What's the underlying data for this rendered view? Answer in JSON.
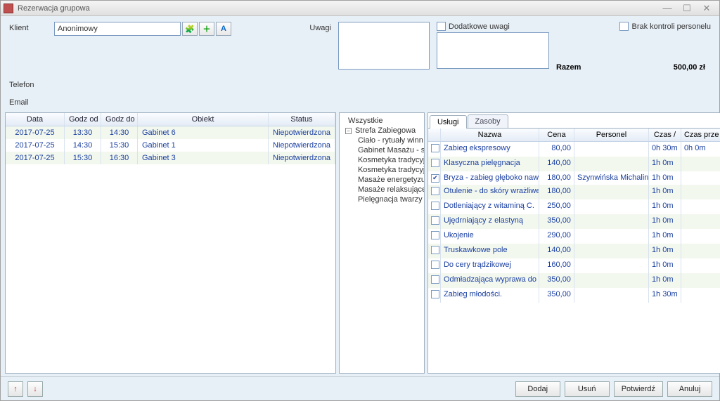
{
  "window": {
    "title": "Rezerwacja grupowa"
  },
  "labels": {
    "klient": "Klient",
    "telefon": "Telefon",
    "email": "Email",
    "uwagi": "Uwagi",
    "dodatkowe_uwagi": "Dodatkowe uwagi",
    "brak_kontroli": "Brak kontroli personelu",
    "razem": "Razem",
    "razem_val": "500,00 zł"
  },
  "client": {
    "value": "Anonimowy"
  },
  "left_grid": {
    "headers": {
      "data": "Data",
      "godz_od": "Godz od",
      "godz_do": "Godz do",
      "obiekt": "Obiekt",
      "status": "Status"
    },
    "rows": [
      {
        "data": "2017-07-25",
        "od": "13:30",
        "do": "14:30",
        "obiekt": "Gabinet 6",
        "status": "Niepotwierdzona"
      },
      {
        "data": "2017-07-25",
        "od": "14:30",
        "do": "15:30",
        "obiekt": "Gabinet 1",
        "status": "Niepotwierdzona"
      },
      {
        "data": "2017-07-25",
        "od": "15:30",
        "do": "16:30",
        "obiekt": "Gabinet 3",
        "status": "Niepotwierdzona"
      }
    ]
  },
  "tree": {
    "root": "Wszystkie",
    "group": "Strefa Zabiegowa",
    "children": [
      "Ciało - rytuały winn",
      "Gabinet Masażu - sta",
      "Kosmetyka tradycyjna",
      "Kosmetyka tradycyjna",
      "Masaże energetyzując",
      "Masaże relaksujące",
      "Pielęgnacja twarzy -"
    ]
  },
  "tabs": {
    "uslugi": "Usługi",
    "zasoby": "Zasoby"
  },
  "services": {
    "headers": {
      "nazwa": "Nazwa",
      "cena": "Cena",
      "personel": "Personel",
      "czas": "Czas  /",
      "czas_prz": "Czas prze"
    },
    "rows": [
      {
        "chk": false,
        "nazwa": "Zabieg ekspresowy",
        "cena": "80,00",
        "personel": "",
        "czas": "0h 30m",
        "czas_prz": "0h 0m"
      },
      {
        "chk": false,
        "nazwa": "Klasyczna pielęgnacja",
        "cena": "140,00",
        "personel": "",
        "czas": "1h 0m",
        "czas_prz": ""
      },
      {
        "chk": true,
        "nazwa": "Bryza - zabieg głęboko nawilżają",
        "cena": "180,00",
        "personel": "Szynwińska Michalina",
        "czas": "1h 0m",
        "czas_prz": ""
      },
      {
        "chk": false,
        "nazwa": "Otulenie - do skóry wrażliwej",
        "cena": "180,00",
        "personel": "",
        "czas": "1h 0m",
        "czas_prz": ""
      },
      {
        "chk": false,
        "nazwa": "Dotleniający z witaminą C.",
        "cena": "250,00",
        "personel": "",
        "czas": "1h 0m",
        "czas_prz": ""
      },
      {
        "chk": false,
        "nazwa": "Ujędrniający z elastyną",
        "cena": "350,00",
        "personel": "",
        "czas": "1h 0m",
        "czas_prz": ""
      },
      {
        "chk": false,
        "nazwa": "Ukojenie",
        "cena": "290,00",
        "personel": "",
        "czas": "1h 0m",
        "czas_prz": ""
      },
      {
        "chk": false,
        "nazwa": "Truskawkowe pole",
        "cena": "140,00",
        "personel": "",
        "czas": "1h 0m",
        "czas_prz": ""
      },
      {
        "chk": false,
        "nazwa": "Do cery trądzikowej",
        "cena": "160,00",
        "personel": "",
        "czas": "1h 0m",
        "czas_prz": ""
      },
      {
        "chk": false,
        "nazwa": "Odmładzająca wyprawa do tropil",
        "cena": "350,00",
        "personel": "",
        "czas": "1h 0m",
        "czas_prz": ""
      },
      {
        "chk": false,
        "nazwa": "Zabieg młodości.",
        "cena": "350,00",
        "personel": "",
        "czas": "1h 30m",
        "czas_prz": ""
      }
    ]
  },
  "buttons": {
    "dodaj": "Dodaj",
    "usun": "Usuń",
    "potwierdz": "Potwierdź",
    "anuluj": "Anuluj"
  }
}
